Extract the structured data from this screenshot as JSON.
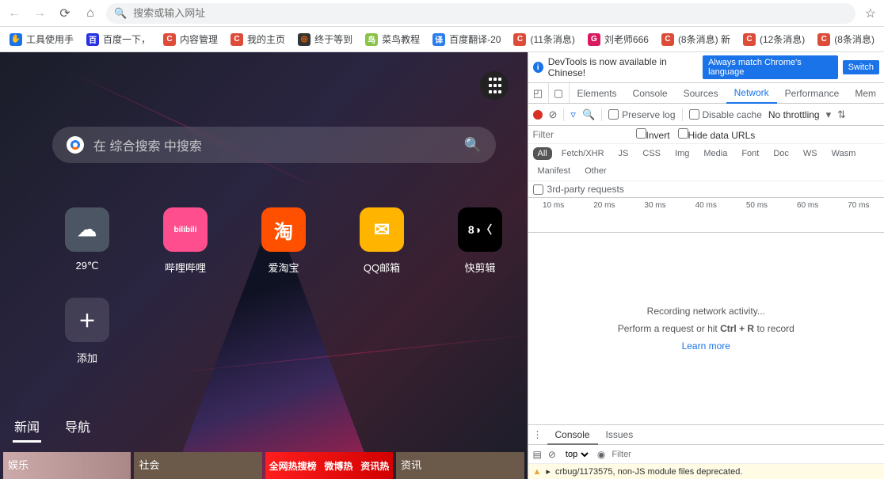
{
  "urlbar": {
    "placeholder": "搜索或输入网址"
  },
  "bookmarks": [
    {
      "label": "工具使用手",
      "color": "#1a73e8",
      "letter": "✋",
      "text": "#1a73e8"
    },
    {
      "label": "百度一下，",
      "color": "#2932e1",
      "letter": "百",
      "text": "#fff"
    },
    {
      "label": "内容管理",
      "color": "#dd4b39",
      "letter": "C",
      "text": "#fff"
    },
    {
      "label": "我的主页",
      "color": "#dd4b39",
      "letter": "C",
      "text": "#fff"
    },
    {
      "label": "终于等到",
      "color": "#333",
      "letter": "◎",
      "text": "#ff6a00"
    },
    {
      "label": "菜鸟教程",
      "color": "#8bc34a",
      "letter": "鸟",
      "text": "#fff"
    },
    {
      "label": "百度翻译-20",
      "color": "#2b7de9",
      "letter": "译",
      "text": "#fff"
    },
    {
      "label": "(11条消息)",
      "color": "#dd4b39",
      "letter": "C",
      "text": "#fff"
    },
    {
      "label": "刘老师666",
      "color": "#d81b60",
      "letter": "G",
      "text": "#fff"
    },
    {
      "label": "(8条消息) 新",
      "color": "#dd4b39",
      "letter": "C",
      "text": "#fff"
    },
    {
      "label": "(12条消息)",
      "color": "#dd4b39",
      "letter": "C",
      "text": "#fff"
    },
    {
      "label": "(8条消息)",
      "color": "#dd4b39",
      "letter": "C",
      "text": "#fff"
    }
  ],
  "page": {
    "search_placeholder": "在 综合搜索 中搜索",
    "tiles": [
      {
        "label": "29℃",
        "bg": "#4b5563",
        "content": "☁",
        "fg": "#fff"
      },
      {
        "label": "哔哩哔哩",
        "bg": "#ff4e8d",
        "content": "bilibili",
        "fg": "#fff",
        "fs": "10px"
      },
      {
        "label": "爱淘宝",
        "bg": "#ff5000",
        "content": "淘",
        "fg": "#fff"
      },
      {
        "label": "QQ邮箱",
        "bg": "#ffb400",
        "content": "✉",
        "fg": "#fff"
      },
      {
        "label": "快剪辑",
        "bg": "#000",
        "content": "8◑〈",
        "fg": "#fff",
        "fs": "14px"
      }
    ],
    "add_label": "添加",
    "nav": [
      "新闻",
      "导航"
    ],
    "thumbs": [
      "娱乐",
      "社会",
      "资讯"
    ],
    "hot": [
      "全网热搜榜",
      "微博热",
      "资讯热"
    ]
  },
  "devtools": {
    "info_text": "DevTools is now available in Chinese!",
    "info_btn1": "Always match Chrome's language",
    "info_btn2": "Switch",
    "tabs": [
      "Elements",
      "Console",
      "Sources",
      "Network",
      "Performance",
      "Mem"
    ],
    "active_tab": "Network",
    "toolbar": {
      "preserve": "Preserve log",
      "disable": "Disable cache",
      "throttle": "No throttling"
    },
    "filter_placeholder": "Filter",
    "invert": "Invert",
    "hide": "Hide data URLs",
    "types": [
      "All",
      "Fetch/XHR",
      "JS",
      "CSS",
      "Img",
      "Media",
      "Font",
      "Doc",
      "WS",
      "Wasm",
      "Manifest",
      "Other"
    ],
    "thirdparty": "3rd-party requests",
    "timeline": [
      "10 ms",
      "20 ms",
      "30 ms",
      "40 ms",
      "50 ms",
      "60 ms",
      "70 ms"
    ],
    "empty1": "Recording network activity...",
    "empty2_a": "Perform a request or hit ",
    "empty2_b": "Ctrl + R",
    "empty2_c": " to record",
    "learn": "Learn more",
    "drawer_tabs": [
      "Console",
      "Issues"
    ],
    "console_top": "top",
    "console_filter": "Filter",
    "warn": "crbug/1173575, non-JS module files deprecated."
  }
}
